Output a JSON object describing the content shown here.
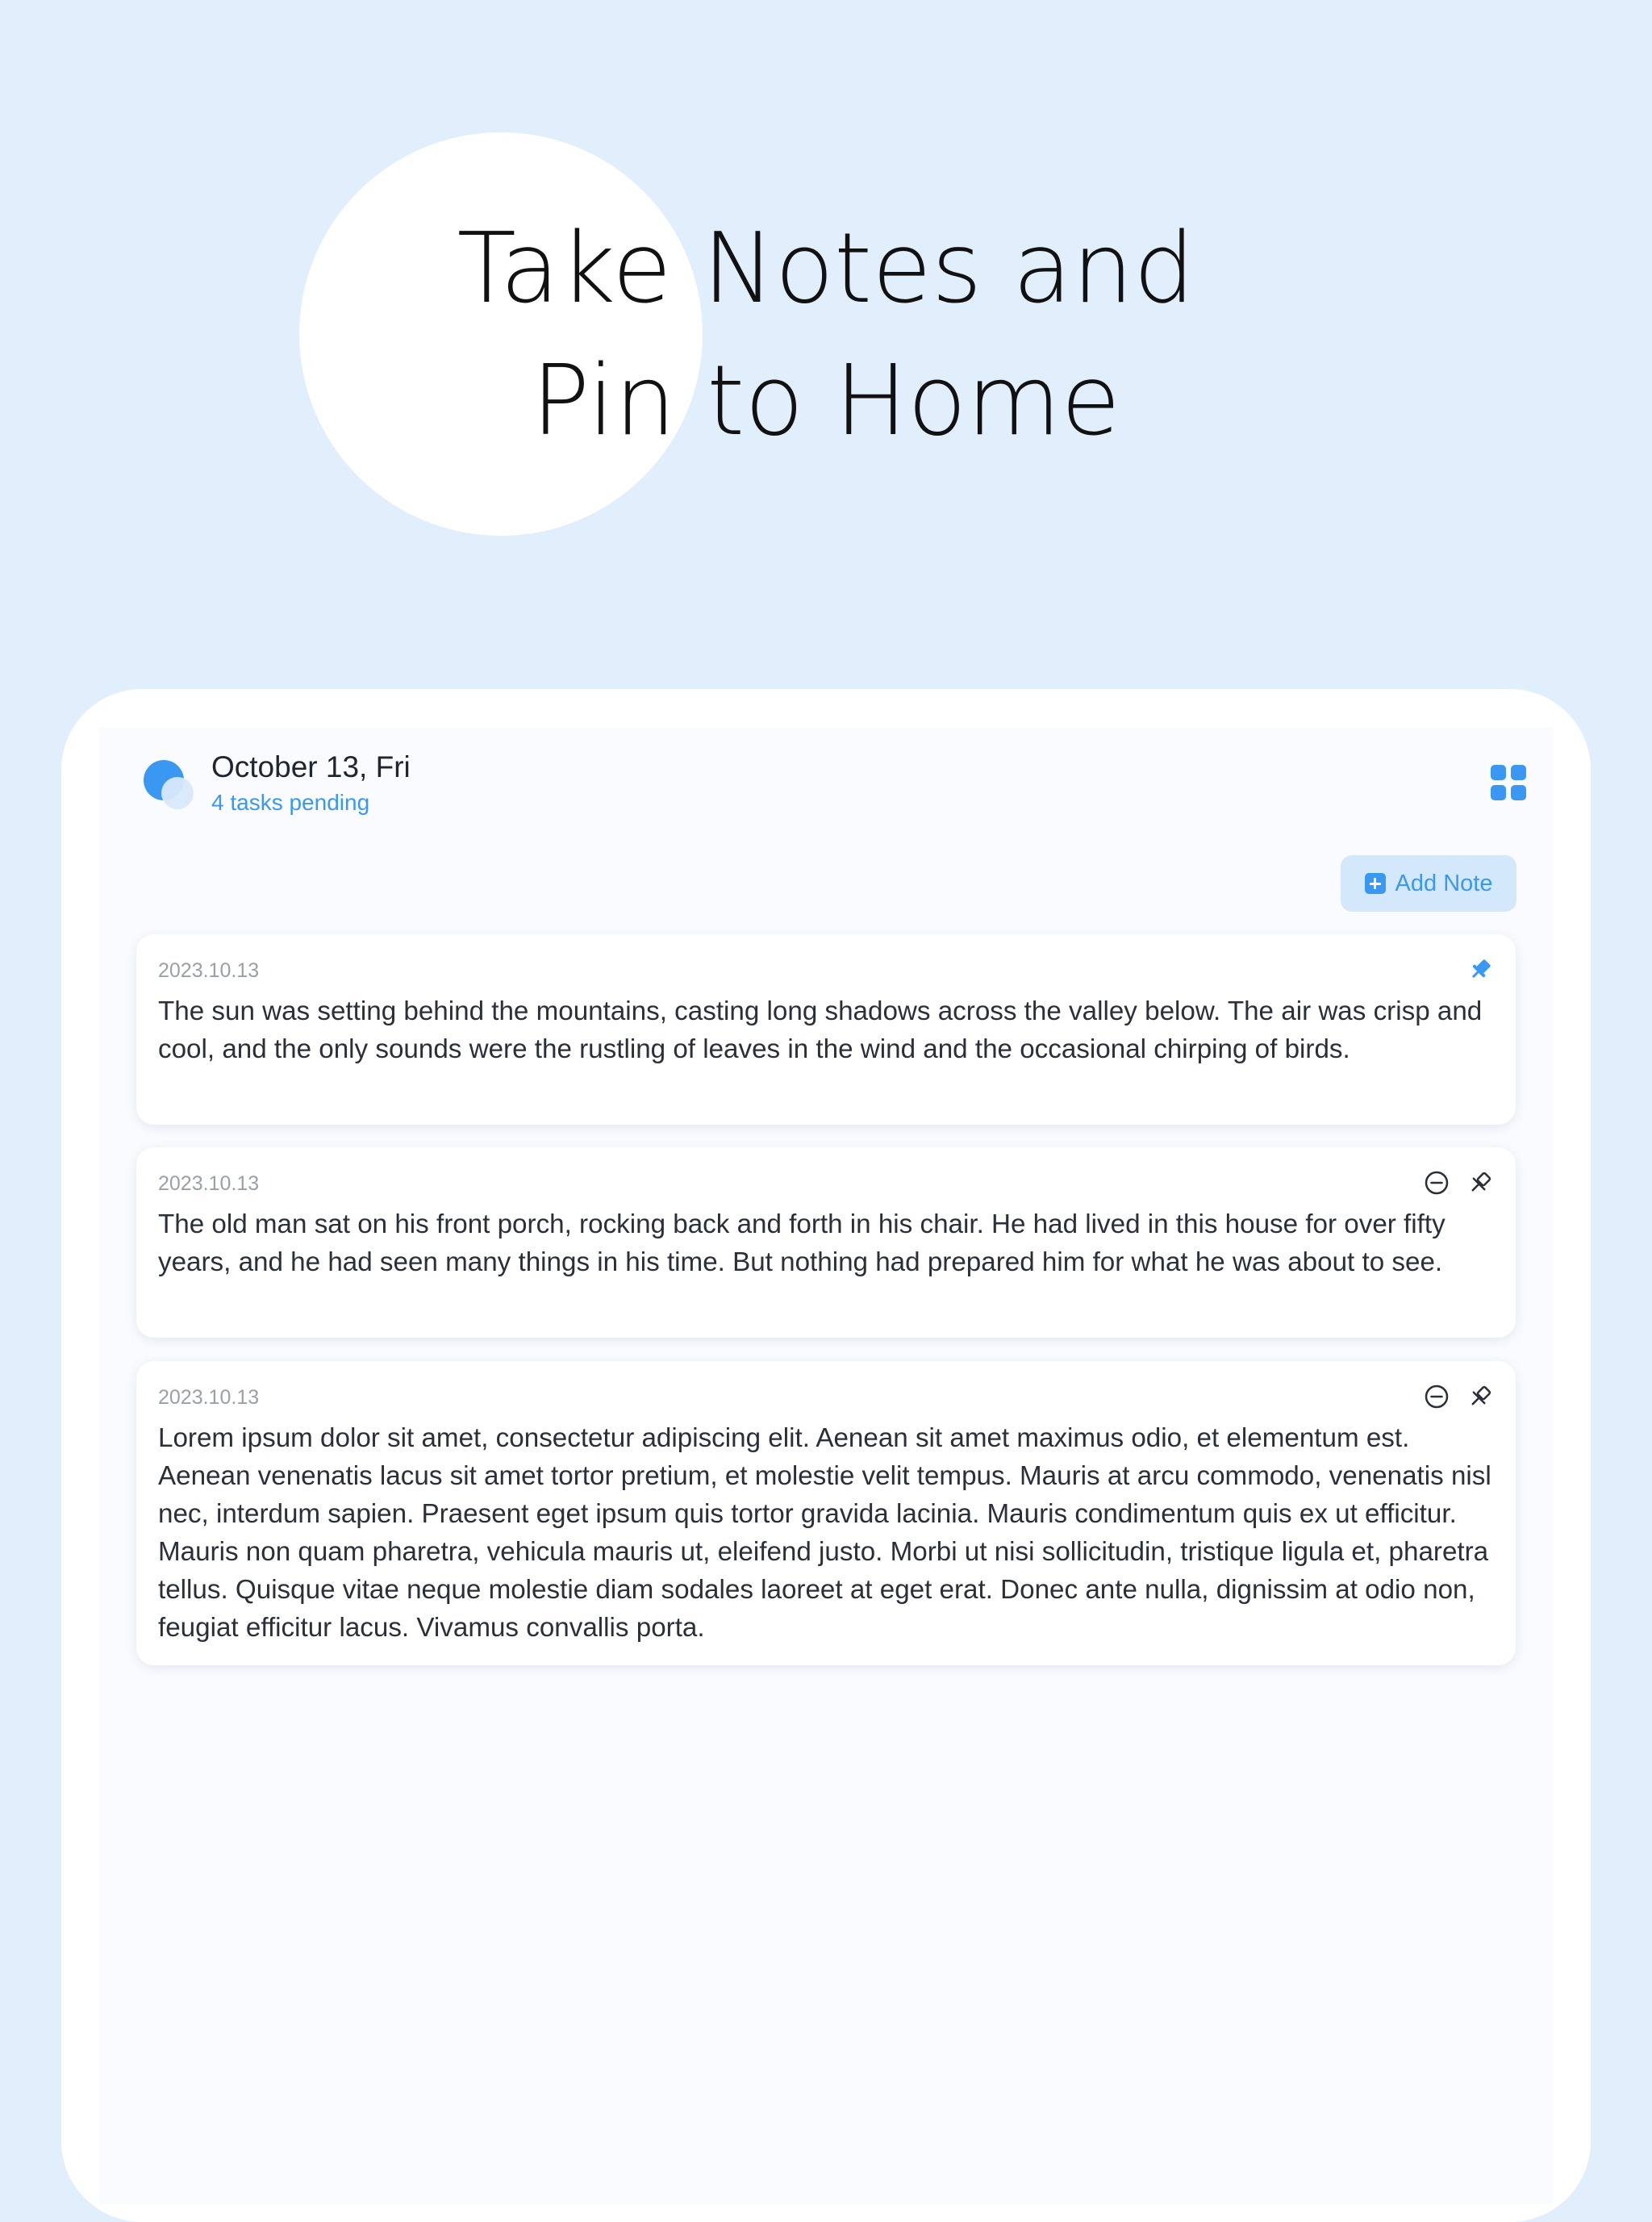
{
  "hero": {
    "title_line1": "Take Notes and",
    "title_line2": "Pin to Home"
  },
  "header": {
    "date": "October 13, Fri",
    "subtitle": "4 tasks pending",
    "layout_icon": "grid-icon"
  },
  "toolbar": {
    "add_note_label": "Add Note",
    "add_note_icon": "plus-square-icon"
  },
  "notes": [
    {
      "date": "2023.10.13",
      "text": "The sun was setting behind the mountains, casting long shadows across the valley below. The air was crisp and cool, and the only sounds were the rustling of leaves in the wind and the occasional chirping of birds.",
      "pinned": true
    },
    {
      "date": "2023.10.13",
      "text": "The old man sat on his front porch, rocking back and forth in his chair. He had lived in this house for over fifty years, and he had seen many things in his time. But nothing had prepared him for what he was about to see.",
      "pinned": false
    },
    {
      "date": "2023.10.13",
      "text": "Lorem ipsum dolor sit amet, consectetur adipiscing elit. Aenean sit amet maximus odio, et elementum est. Aenean venenatis lacus sit amet tortor pretium, et molestie velit tempus. Mauris at arcu commodo, venenatis nisl nec, interdum sapien. Praesent eget ipsum quis tortor gravida lacinia. Mauris condimentum quis ex ut efficitur. Mauris non quam pharetra, vehicula mauris ut, eleifend justo. Morbi ut nisi sollicitudin, tristique ligula et, pharetra tellus. Quisque vitae neque molestie diam sodales laoreet at eget erat. Donec ante nulla, dignissim at odio non, feugiat efficitur lacus. Vivamus convallis porta.",
      "pinned": false
    }
  ],
  "colors": {
    "background": "#e1effd",
    "accent": "#3a98f2",
    "accent_light": "#d4e8fc",
    "text": "#2a2f3a",
    "muted": "#9aa0a8"
  }
}
